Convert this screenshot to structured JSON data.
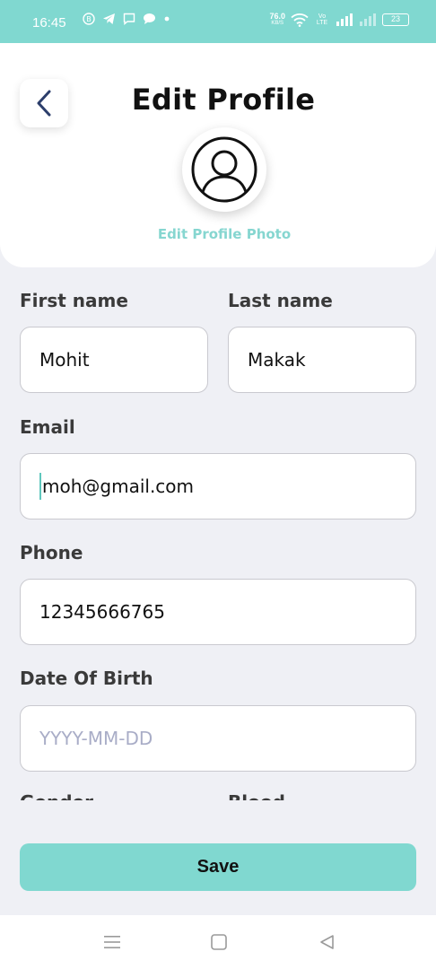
{
  "status_bar": {
    "time": "16:45",
    "net_speed_value": "76.0",
    "net_speed_unit": "KB/S",
    "volte": "Vo LTE",
    "battery": "23"
  },
  "header": {
    "title": "Edit Profile",
    "edit_photo_label": "Edit Profile Photo"
  },
  "form": {
    "first_name_label": "First name",
    "first_name_value": "Mohit",
    "last_name_label": "Last name",
    "last_name_value": "Makak",
    "email_label": "Email",
    "email_value": "moh@gmail.com",
    "phone_label": "Phone",
    "phone_value": "12345666765",
    "dob_label": "Date Of Birth",
    "dob_placeholder": "YYYY-MM-DD",
    "gender_label": "Gender",
    "blood_label": "Blood"
  },
  "actions": {
    "save_label": "Save"
  },
  "colors": {
    "accent": "#80d8d0",
    "background": "#eff0f5",
    "edit_photo_text": "#86d6d0"
  }
}
